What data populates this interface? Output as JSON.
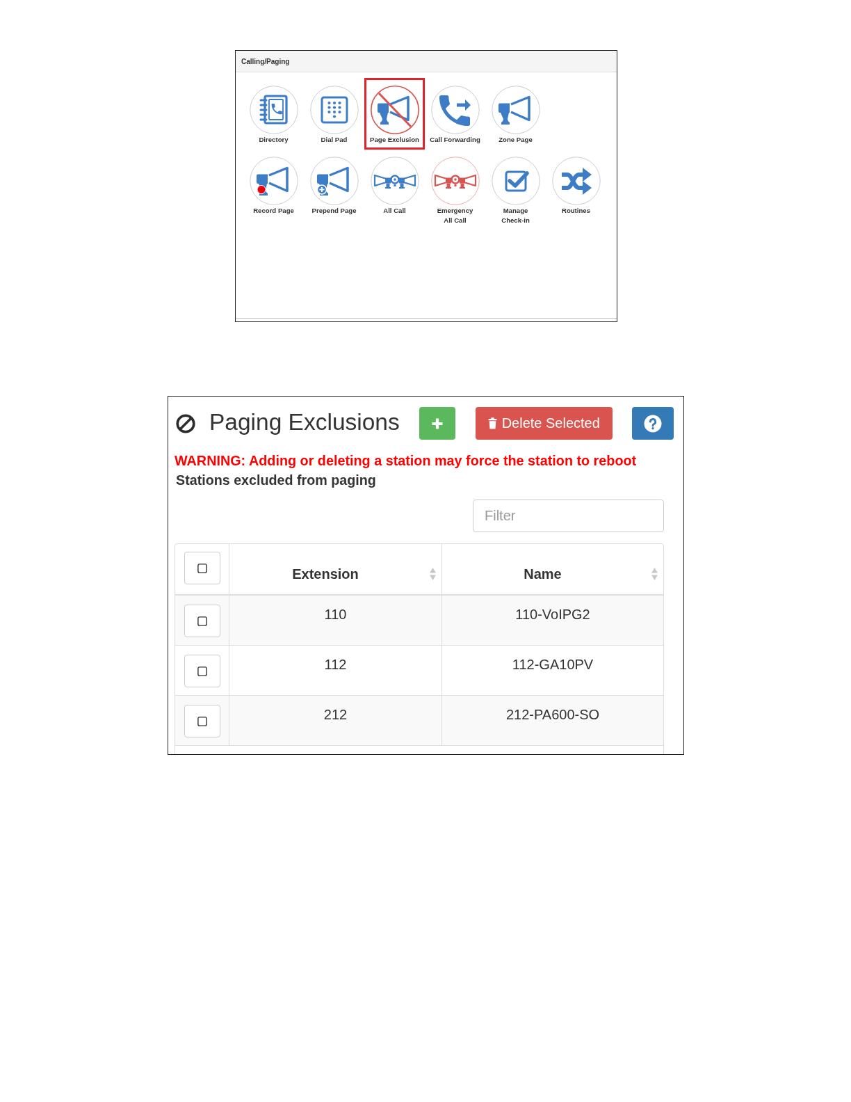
{
  "calling_panel": {
    "title": "Calling/Paging",
    "rows": [
      {
        "items": [
          {
            "kind": "directory",
            "label": "Directory",
            "highlighted": false
          },
          {
            "kind": "dialpad",
            "label": "Dial Pad",
            "highlighted": false
          },
          {
            "kind": "page_exclusion",
            "label": "Page Exclusion",
            "highlighted": true
          },
          {
            "kind": "call_forwarding",
            "label": "Call Forwarding",
            "highlighted": false
          },
          {
            "kind": "zone_page",
            "label": "Zone Page",
            "highlighted": false
          }
        ]
      },
      {
        "items": [
          {
            "kind": "record_page",
            "label": "Record Page",
            "highlighted": false
          },
          {
            "kind": "prepend_page",
            "label": "Prepend Page",
            "highlighted": false
          },
          {
            "kind": "all_call",
            "label": "All Call",
            "highlighted": false
          },
          {
            "kind": "emergency_all_call",
            "label": "Emergency\nAll Call",
            "highlighted": false
          },
          {
            "kind": "manage_checkin",
            "label": "Manage\nCheck-in",
            "highlighted": false
          },
          {
            "kind": "routines",
            "label": "Routines",
            "highlighted": false
          }
        ]
      }
    ]
  },
  "exclusions_panel": {
    "title": "Paging Exclusions",
    "buttons": [
      {
        "kind": "add"
      },
      {
        "kind": "delete",
        "label": "Delete Selected"
      },
      {
        "kind": "help"
      }
    ],
    "warning": "WARNING: Adding or deleting a station may force the station to reboot",
    "subtitle": "Stations excluded from paging",
    "filter": {
      "placeholder": "Filter"
    },
    "table": {
      "select_all": {
        "checked": false
      },
      "columns": [
        {
          "label": "Extension"
        },
        {
          "label": "Name"
        }
      ],
      "rows": [
        {
          "checked": false,
          "cells": [
            "110",
            "110-VoIPG2"
          ]
        },
        {
          "checked": false,
          "cells": [
            "112",
            "112-GA10PV"
          ]
        },
        {
          "checked": false,
          "cells": [
            "212",
            "212-PA600-SO"
          ]
        }
      ]
    }
  }
}
